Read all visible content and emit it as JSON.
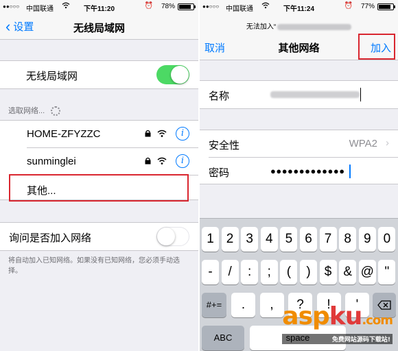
{
  "left": {
    "status": {
      "signal": "●●○○○",
      "carrier": "中国联通",
      "time": "下午11:20",
      "battery": "78%",
      "battery_level": 0.78
    },
    "nav": {
      "back": "设置",
      "title": "无线局域网"
    },
    "wifi_toggle": {
      "label": "无线局域网",
      "on": true
    },
    "choose_header": "选取网络...",
    "networks": [
      {
        "name": "HOME-ZFYZZC",
        "locked": true
      },
      {
        "name": "sunminglei",
        "locked": true
      }
    ],
    "other": "其他...",
    "ask_toggle": {
      "label": "询问是否加入网络",
      "on": false
    },
    "footnote": "将自动加入已知网络。如果没有已知网络，您必须手动选择。"
  },
  "right": {
    "status": {
      "signal": "●●○○○",
      "carrier": "中国联通",
      "time": "下午11:24",
      "battery": "77%",
      "battery_level": 0.77
    },
    "prompt": "无法加入“",
    "nav": {
      "cancel": "取消",
      "title": "其他网络",
      "join": "加入"
    },
    "name_label": "名称",
    "security_label": "安全性",
    "security_value": "WPA2",
    "password_label": "密码",
    "password_value": "●●●●●●●●●●●●●",
    "keyboard": {
      "row1": [
        "1",
        "2",
        "3",
        "4",
        "5",
        "6",
        "7",
        "8",
        "9",
        "0"
      ],
      "row2": [
        "-",
        "/",
        ":",
        ";",
        "(",
        ")",
        "$",
        "&",
        "@",
        "\""
      ],
      "row3_left": "#+=",
      "row3": [
        ".",
        ",",
        "?",
        "!",
        "'"
      ],
      "bottom_left": "ABC",
      "space": "space"
    }
  },
  "watermark": {
    "brand_a": "asp",
    "brand_b": "ku",
    "brand_c": ".com",
    "sub": "免费网站源码下载站!"
  },
  "colors": {
    "accent": "#007aff",
    "toggle_on": "#4cd964",
    "highlight": "#d9262f"
  }
}
